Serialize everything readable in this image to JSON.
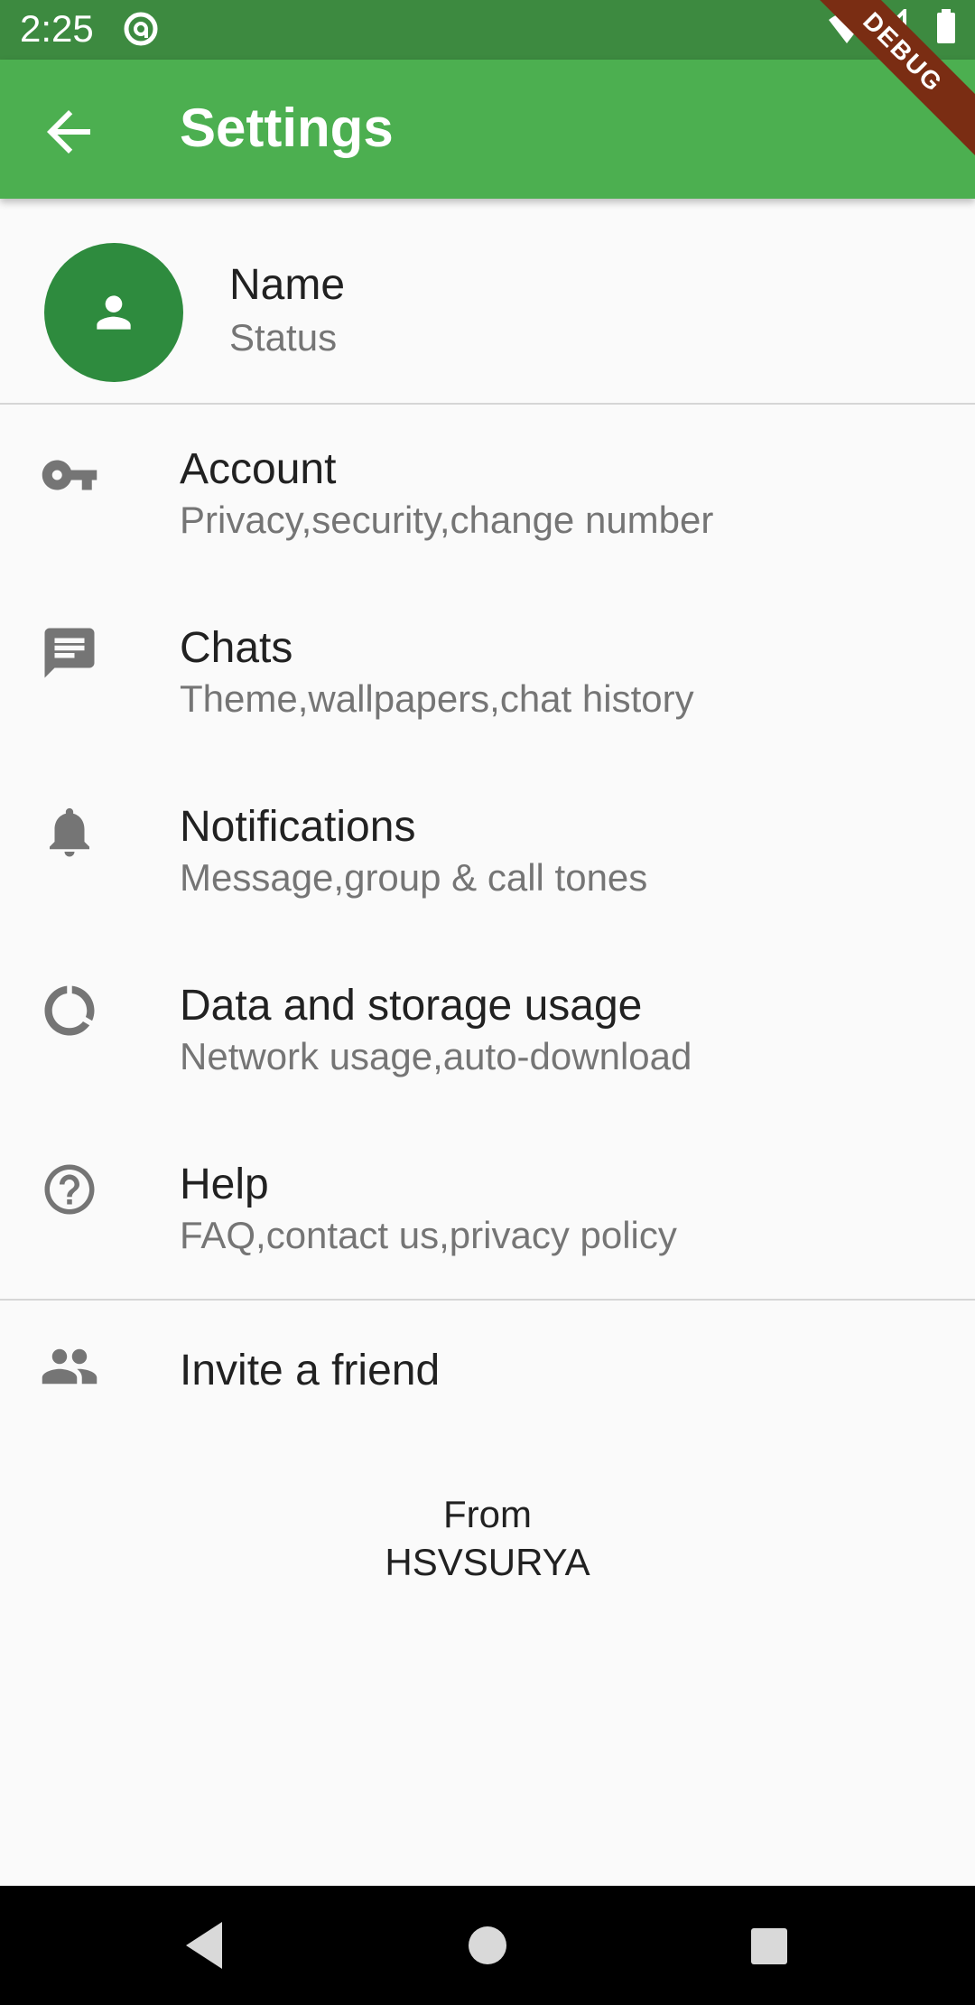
{
  "status_bar": {
    "time": "2:25",
    "icons": [
      "at-icon",
      "wifi-icon",
      "signal-icon",
      "battery-icon"
    ]
  },
  "app_bar": {
    "title": "Settings",
    "back_icon": "arrow-back-icon",
    "color": "#4caf50"
  },
  "debug_banner": "DEBUG",
  "profile": {
    "name": "Name",
    "status": "Status",
    "avatar_color": "#2e8b3e"
  },
  "settings": [
    {
      "title": "Account",
      "subtitle": "Privacy,security,change number",
      "icon": "key-icon"
    },
    {
      "title": "Chats",
      "subtitle": "Theme,wallpapers,chat history",
      "icon": "chat-icon"
    },
    {
      "title": "Notifications",
      "subtitle": "Message,group & call tones",
      "icon": "bell-icon"
    },
    {
      "title": "Data and storage usage",
      "subtitle": "Network usage,auto-download",
      "icon": "data-usage-icon"
    },
    {
      "title": "Help",
      "subtitle": "FAQ,contact us,privacy policy",
      "icon": "help-icon"
    }
  ],
  "invite": {
    "label": "Invite a friend",
    "icon": "people-icon"
  },
  "footer": {
    "line1": "From",
    "line2": "HSVSURYA"
  }
}
